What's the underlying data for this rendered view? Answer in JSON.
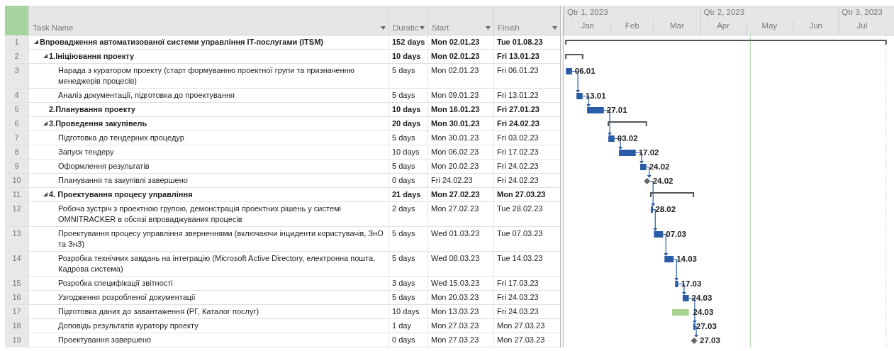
{
  "columns": [
    {
      "label": "Task Name"
    },
    {
      "label": "Duratic"
    },
    {
      "label": "Start"
    },
    {
      "label": "Finish"
    }
  ],
  "timescale": {
    "quarters": [
      "Qtr 1, 2023",
      "Qtr 2, 2023",
      "Qtr 3, 2023"
    ],
    "months": [
      "Jan",
      "Feb",
      "Mar",
      "Apr",
      "May",
      "Jun",
      "Jul"
    ]
  },
  "tasks": [
    {
      "id": "1",
      "name": "Впровадження автоматизованої системи управління IT-послугами (ITSM)",
      "duration": "152 days",
      "start": "Mon 02.01.23",
      "finish": "Tue 01.08.23",
      "kind": "summary",
      "bold": true,
      "expanded": true,
      "children": [
        {
          "id": "2",
          "name": "1.Ініціювання проекту",
          "duration": "10 days",
          "start": "Mon 02.01.23",
          "finish": "Fri 13.01.23",
          "kind": "summary",
          "bold": true,
          "expanded": true,
          "children": [
            {
              "id": "3",
              "name": "Нарада з куратором проекту (старт формуванню проектної групи та призначенню менеджерів процесів)",
              "duration": "5 days",
              "start": "Mon 02.01.23",
              "finish": "Fri 06.01.23",
              "kind": "task",
              "bold": false,
              "bar_label": "06.01"
            },
            {
              "id": "4",
              "name": "Аналіз документації, підготовка до проектування",
              "duration": "5 days",
              "start": "Mon 09.01.23",
              "finish": "Fri 13.01.23",
              "kind": "task",
              "bold": false,
              "bar_label": "13.01"
            }
          ]
        },
        {
          "id": "5",
          "name": "2.Планування проекту",
          "duration": "10 days",
          "start": "Mon 16.01.23",
          "finish": "Fri 27.01.23",
          "kind": "task",
          "bold": true,
          "bar_label": "27.01"
        },
        {
          "id": "6",
          "name": "3.Проведення закупівель",
          "duration": "20 days",
          "start": "Mon 30.01.23",
          "finish": "Fri 24.02.23",
          "kind": "summary",
          "bold": true,
          "expanded": true,
          "children": [
            {
              "id": "7",
              "name": "Підготовка до тендерних процедур",
              "duration": "5 days",
              "start": "Mon 30.01.23",
              "finish": "Fri 03.02.23",
              "kind": "task",
              "bold": false,
              "bar_label": "03.02"
            },
            {
              "id": "8",
              "name": "Запуск тендеру",
              "duration": "10 days",
              "start": "Mon 06.02.23",
              "finish": "Fri 17.02.23",
              "kind": "task",
              "bold": false,
              "bar_label": "17.02"
            },
            {
              "id": "9",
              "name": "Оформлення результатів",
              "duration": "5 days",
              "start": "Mon 20.02.23",
              "finish": "Fri 24.02.23",
              "kind": "task",
              "bold": false,
              "bar_label": "24.02"
            },
            {
              "id": "10",
              "name": "Планування та закупівлі завершено",
              "duration": "0 days",
              "start": "Fri 24.02.23",
              "finish": "Fri 24.02.23",
              "kind": "milestone",
              "bold": false,
              "bar_label": "24.02"
            }
          ]
        },
        {
          "id": "11",
          "name": "4. Проектування процесу управління",
          "duration": "21 days",
          "start": "Mon 27.02.23",
          "finish": "Mon 27.03.23",
          "kind": "summary",
          "bold": true,
          "expanded": true,
          "children": [
            {
              "id": "12",
              "name": "Робоча зустріч з проектною групою, демонстрація проектних рішень у системі OMNITRACKER в обсязі впроваджуваних процесів",
              "duration": "2 days",
              "start": "Mon 27.02.23",
              "finish": "Tue 28.02.23",
              "kind": "task",
              "bold": false,
              "bar_label": "28.02"
            },
            {
              "id": "13",
              "name": "Проектування процесу управління зверненнями (включаючи інциденти користувачів, ЗнО та ЗнЗ)",
              "duration": "5 days",
              "start": "Wed 01.03.23",
              "finish": "Tue 07.03.23",
              "kind": "task",
              "bold": false,
              "bar_label": "07.03"
            },
            {
              "id": "14",
              "name": "Розробка технічних завдань на інтеграцію (Microsoft Active Directory, електронна пошта, Кадрова система)",
              "duration": "5 days",
              "start": "Wed 08.03.23",
              "finish": "Tue 14.03.23",
              "kind": "task",
              "bold": false,
              "bar_label": "14.03"
            },
            {
              "id": "15",
              "name": "Розробка специфікації звітності",
              "duration": "3 days",
              "start": "Wed 15.03.23",
              "finish": "Fri 17.03.23",
              "kind": "task",
              "bold": false,
              "bar_label": "17.03"
            },
            {
              "id": "16",
              "name": "Узгодження розробленої документації",
              "duration": "5 days",
              "start": "Mon 20.03.23",
              "finish": "Fri 24.03.23",
              "kind": "task",
              "bold": false,
              "bar_label": "24.03"
            },
            {
              "id": "17",
              "name": "Підготовка даних до завантаження (РГ, Каталог послуг)",
              "duration": "10 days",
              "start": "Mon 13.03.23",
              "finish": "Fri 24.03.23",
              "kind": "highlighted",
              "bold": false,
              "bar_label": "24.03"
            },
            {
              "id": "18",
              "name": "Доповідь результатів куратору проекту",
              "duration": "1 day",
              "start": "Mon 27.03.23",
              "finish": "Mon 27.03.23",
              "kind": "task",
              "bold": false,
              "bar_label": "27.03"
            },
            {
              "id": "19",
              "name": "Проектування завершено",
              "duration": "0 days",
              "start": "Mon 27.03.23",
              "finish": "Mon 27.03.23",
              "kind": "milestone",
              "bold": false,
              "bar_label": "27.03"
            }
          ]
        }
      ]
    }
  ]
}
